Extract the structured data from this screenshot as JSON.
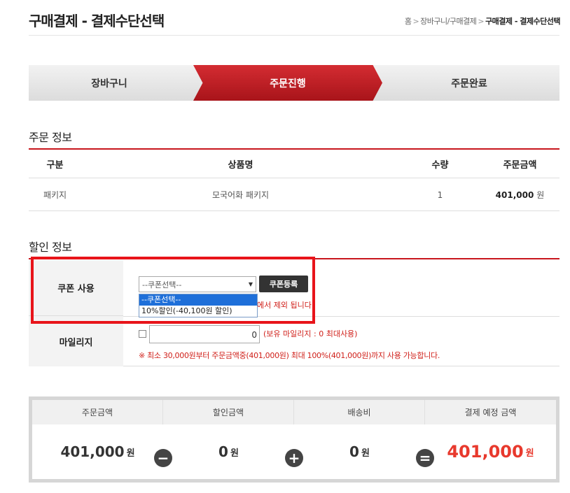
{
  "header": {
    "title": "구매결제 - 결제수단선택",
    "breadcrumb": [
      "홈",
      "장바구니/구매결제",
      "구매결제 - 결제수단선택"
    ],
    "separator": ">"
  },
  "steps": [
    "장바구니",
    "주문진행",
    "주문완료"
  ],
  "order": {
    "title": "주문 정보",
    "headers": [
      "구분",
      "상품명",
      "수량",
      "주문금액"
    ],
    "row": {
      "type": "패키지",
      "name": "모국어화 패키지",
      "qty": "1",
      "amount": "401,000",
      "unit": "원"
    }
  },
  "discount": {
    "title": "할인 정보",
    "coupon_label": "쿠폰 사용",
    "coupon_selected": "--쿠폰선택--",
    "coupon_options": [
      "--쿠폰선택--",
      "10%할인(-40,100원 할인)"
    ],
    "coupon_button": "쿠폰등록",
    "coupon_note": "에서 제외 됩니다.",
    "mileage_label": "마일리지",
    "mileage_value": "0",
    "mileage_info": "(보유 마일리지 : 0 최대사용)",
    "mileage_note": "※ 최소 30,000원부터 주문금액중(401,000원) 최대 100%(401,000원)까지 사용 가능합니다."
  },
  "summary": {
    "order_amount_label": "주문금액",
    "order_amount": "401,000",
    "discount_label": "할인금액",
    "discount_amount": "0",
    "shipping_label": "배송비",
    "shipping_amount": "0",
    "total_label": "결제 예정 금액",
    "total_amount": "401,000",
    "unit": "원",
    "minus": "−",
    "plus": "+",
    "equals": "="
  },
  "colors": {
    "accent": "#c8161d",
    "total": "#e8392d",
    "highlight": "#e8141a"
  }
}
